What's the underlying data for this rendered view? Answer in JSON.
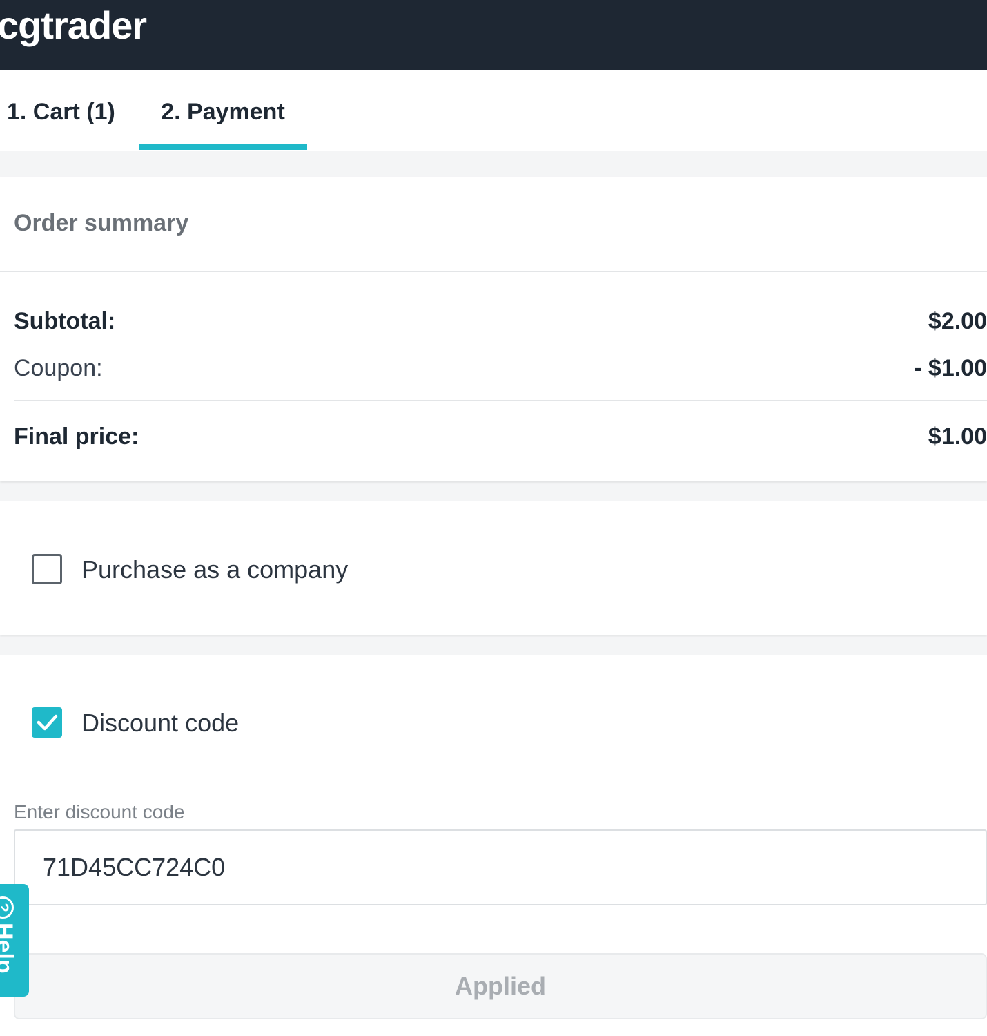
{
  "header": {
    "logo_text": "cgtrader"
  },
  "tabs": [
    {
      "label": "1. Cart (1)",
      "active": false
    },
    {
      "label": "2. Payment",
      "active": true
    }
  ],
  "order_summary": {
    "title": "Order summary",
    "subtotal_label": "Subtotal:",
    "subtotal_value": "$2.00",
    "coupon_label": "Coupon:",
    "coupon_value": "- $1.00",
    "final_label": "Final price:",
    "final_value": "$1.00"
  },
  "company": {
    "checkbox_label": "Purchase as a company",
    "checked": false
  },
  "discount": {
    "checkbox_label": "Discount code",
    "checked": true,
    "input_label": "Enter discount code",
    "input_value": "71D45CC724C0",
    "button_label": "Applied"
  },
  "help": {
    "label": "Help",
    "icon": "question-circle-icon"
  },
  "colors": {
    "topbar": "#1e2733",
    "accent": "#1fb9c9",
    "background": "#f4f5f6"
  }
}
